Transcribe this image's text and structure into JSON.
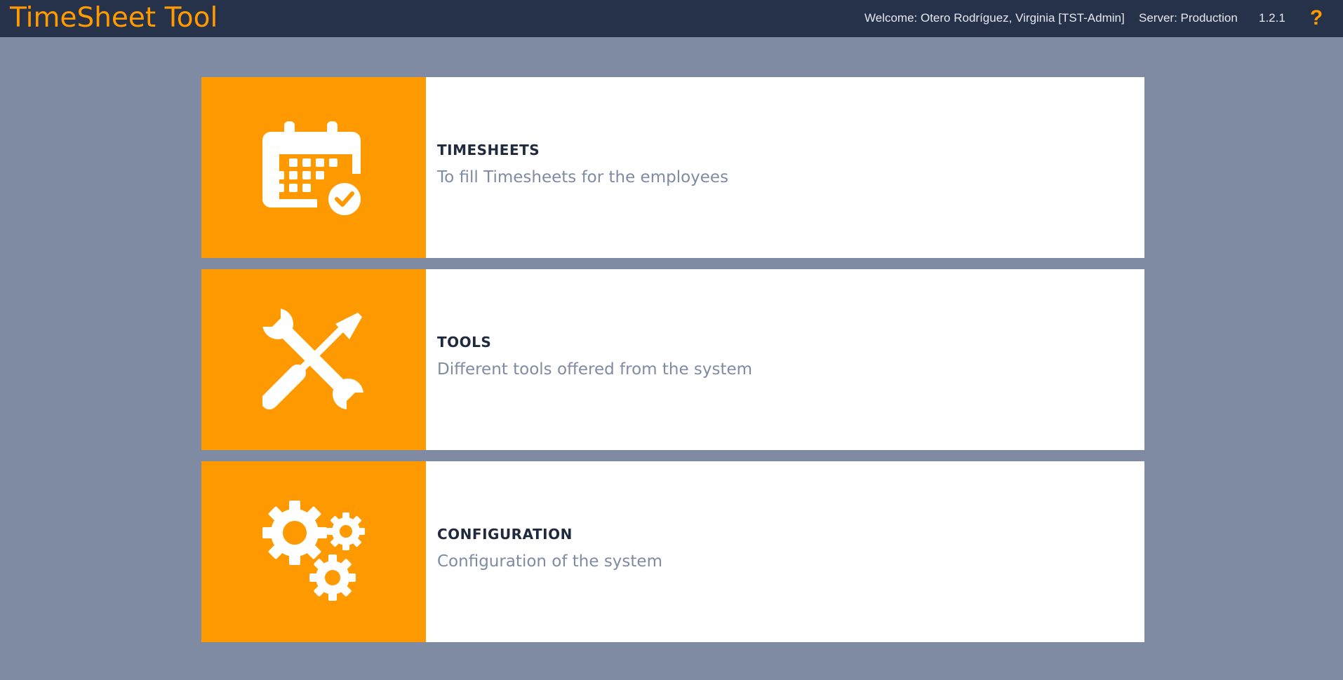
{
  "header": {
    "app_title": "TimeSheet Tool",
    "welcome": "Welcome: Otero Rodríguez, Virginia [TST-Admin]",
    "server": "Server: Production",
    "version": "1.2.1",
    "help_label": "?",
    "help_icon": "question-mark-icon"
  },
  "cards": [
    {
      "title": "TIMESHEETS",
      "description": "To fill Timesheets for the employees",
      "icon": "calendar-check-icon"
    },
    {
      "title": "TOOLS",
      "description": "Different tools offered from the system",
      "icon": "wrench-screwdriver-icon"
    },
    {
      "title": "CONFIGURATION",
      "description": "Configuration of the system",
      "icon": "gears-icon"
    }
  ],
  "colors": {
    "header_bg": "#26314a",
    "page_bg": "#7f8aa3",
    "accent": "#ff9900",
    "card_bg": "#ffffff",
    "title_text": "#1f2a3e",
    "desc_text": "#7f8aa3"
  }
}
